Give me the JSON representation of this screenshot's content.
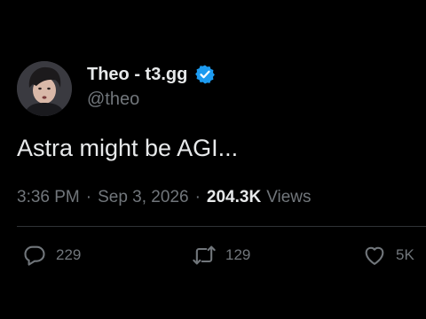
{
  "author": {
    "display_name": "Theo - t3.gg",
    "handle": "@theo",
    "verified": true,
    "verified_color": "#1d9bf0",
    "avatar": "person-avatar"
  },
  "tweet": {
    "text": "Astra might be AGI..."
  },
  "meta": {
    "time": "3:36 PM",
    "separator": "·",
    "date": "Sep 3, 2026",
    "views_count": "204.3K",
    "views_label": "Views"
  },
  "actions": {
    "reply": {
      "icon": "reply-icon",
      "count": "229"
    },
    "retweet": {
      "icon": "retweet-icon",
      "count": "129"
    },
    "like": {
      "icon": "heart-icon",
      "count": "5K"
    }
  },
  "colors": {
    "background": "#000000",
    "text_primary": "#e7e9ea",
    "text_secondary": "#71767b",
    "divider": "#2f3336"
  }
}
